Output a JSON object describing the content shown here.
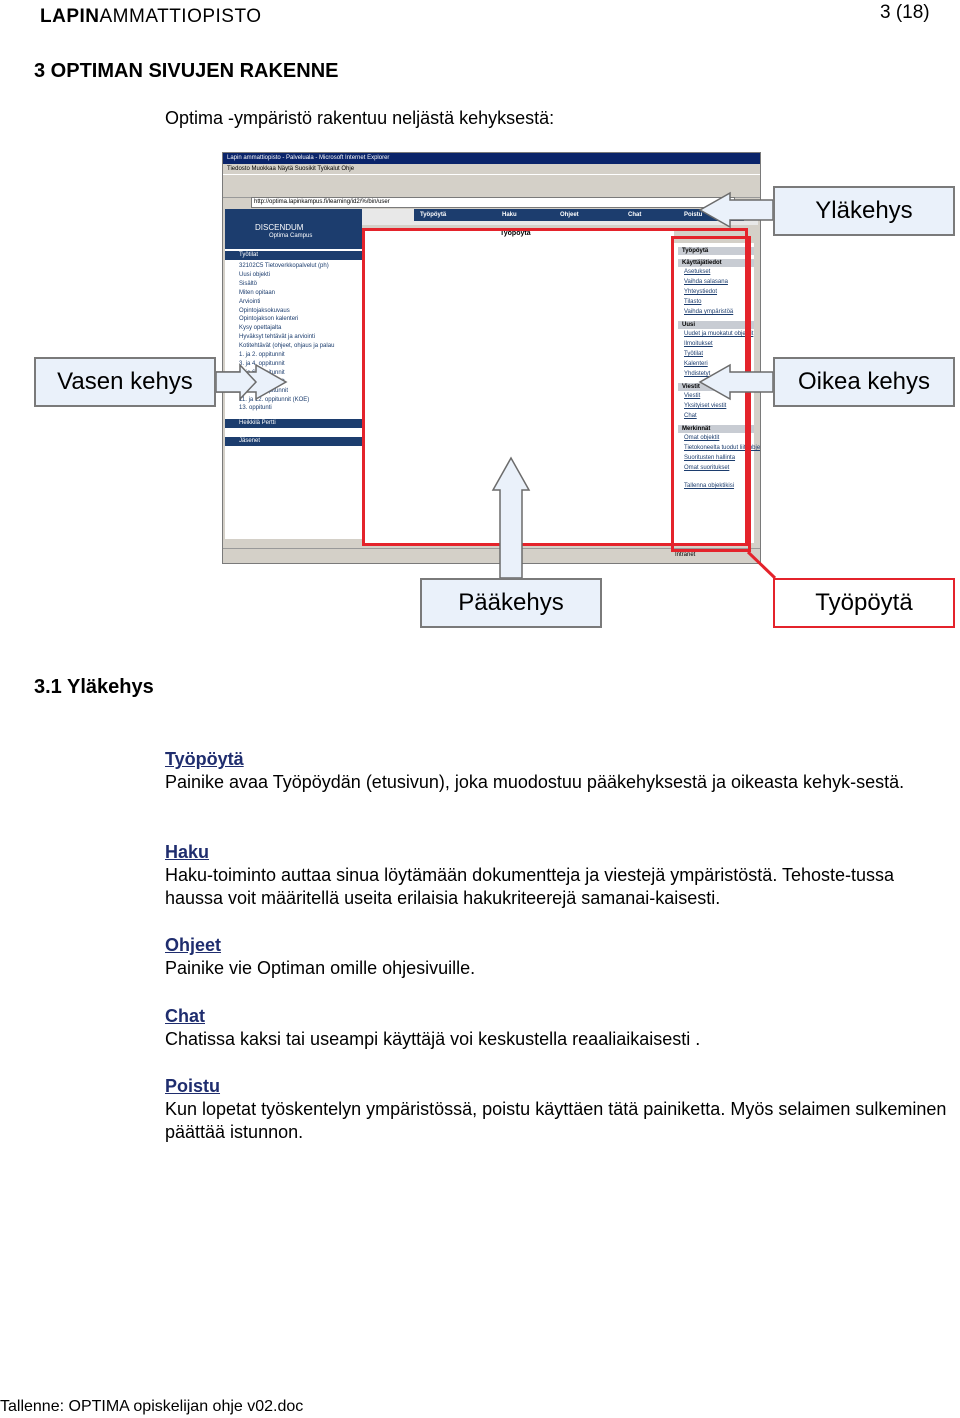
{
  "header": {
    "logo_bold": "LAPIN",
    "logo_thin": "AMMATTIOPISTO",
    "page_number": "3 (18)"
  },
  "title": "3 OPTIMAN SIVUJEN RAKENNE",
  "intro": "Optima -ympäristö rakentuu neljästä kehyksestä:",
  "callouts": {
    "top": "Yläkehys",
    "left": "Vasen kehys",
    "right": "Oikea kehys",
    "main": "Pääkehys",
    "desk": "Työpöytä"
  },
  "screenshot": {
    "window_title": "Lapin ammattiopisto - Palveluala - Microsoft Internet Explorer",
    "menu": "Tiedosto  Muokkaa  Näytä  Suosikit  Työkalut  Ohje",
    "address": "http://optima.lapinkampus.fi/learning/id2/%/bin/user",
    "brand_line1": "DISCENDUM",
    "brand_line2": "Optima Campus",
    "nav": [
      "Työpöytä",
      "Haku",
      "Ohjeet",
      "Chat",
      "Poistu"
    ],
    "main_title": "Työpöytä",
    "left_bar_top": "Työtilat",
    "left_items": [
      "32102C5 Tietoverkkopalvelut (ph)",
      "Uusi objekti",
      "Sisältö",
      "Miten opitaan",
      "Arviointi",
      "Opintojaksokuvaus",
      "Opintojakson kalenteri",
      "Kysy opettajalta",
      "Hyväksyt tehtävät ja arviointi",
      "Kotitehtävät (ohjeet, ohjaus ja palau",
      "1. ja 2. oppitunnit",
      "3. ja 4. oppitunnit",
      "5. ja 6. oppitunnit",
      "7. ja 8. oppitunnit",
      "9. ja 10. oppitunnit",
      "11. ja 12. oppitunnit (KOE)",
      "13. oppitunti"
    ],
    "left_bar_user": "Heikkilä Pertti",
    "left_bar_members": "Jäsenet",
    "right_sections": [
      {
        "title": "Työpöytä",
        "items": []
      },
      {
        "title": "Käyttäjätiedot",
        "items": [
          "Asetukset",
          "Vaihda salasana",
          "Yhteystiedot",
          "Tilasto",
          "Vaihda ympäristöä"
        ]
      },
      {
        "title": "Uusi",
        "items": [
          "Uudet ja muokatut objektit",
          "Ilmoitukset",
          "Työtilat",
          "Kalenteri",
          "Yhdistetyt"
        ]
      },
      {
        "title": "Viestit",
        "items": [
          "Viestit",
          "Yksityiset viestit",
          "Chat"
        ]
      },
      {
        "title": "Merkinnät",
        "items": [
          "Omat objektit",
          "Tietokoneelta tuodut liiteobjektit",
          "Suoritusten hallinta",
          "Omat suoritukset"
        ]
      }
    ],
    "right_footer": "Tallenna objektikisi",
    "status_right": "Intranet"
  },
  "section_title": "3.1 Yläkehys",
  "sections": [
    {
      "title": "Työpöytä",
      "text": "Painike avaa Työpöydän (etusivun), joka muodostuu pääkehyksestä ja oikeasta kehyk-sestä."
    },
    {
      "title": "Haku",
      "text": "Haku-toiminto auttaa sinua löytämään dokumentteja ja viestejä ympäristöstä. Tehoste-tussa haussa voit määritellä useita erilaisia hakukriteerejä samanai-kaisesti."
    },
    {
      "title": "Ohjeet",
      "text": "Painike vie Optiman omille ohjesivuille."
    },
    {
      "title": "Chat",
      "text": "Chatissa kaksi tai useampi käyttäjä voi keskustella reaaliaikaisesti ."
    },
    {
      "title": "Poistu",
      "text": "Kun lopetat työskentelyn ympäristössä, poistu käyttäen tätä painiketta. Myös selaimen sulkeminen päättää istunnon."
    }
  ],
  "footer": "Tallenne: OPTIMA opiskelijan ohje v02.doc",
  "colors": {
    "accent": "#1f2d6e",
    "frame": "#e4232b",
    "callout": "#eaf1fa"
  }
}
